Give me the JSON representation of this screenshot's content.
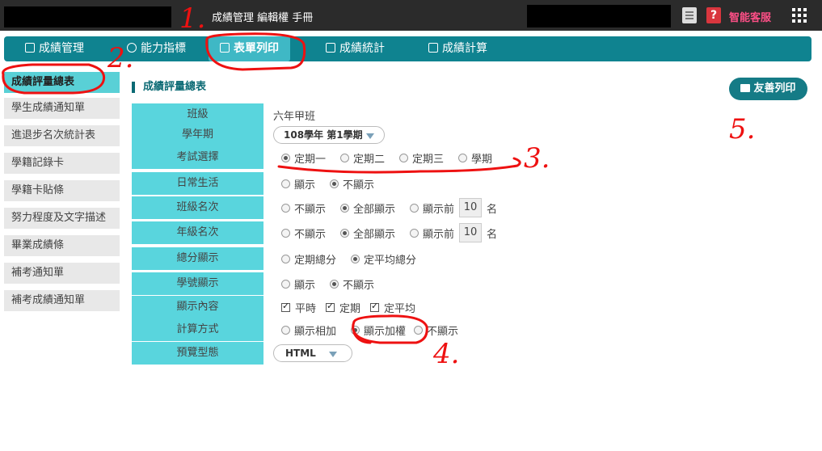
{
  "topbar": {
    "title": "成績管理 編輯權 手冊",
    "service_label": "智能客服",
    "icons": [
      "clipboard-icon",
      "help-icon",
      "apps-grid-icon"
    ]
  },
  "nav": {
    "items": [
      {
        "label": "成績管理",
        "icon": "doc-icon"
      },
      {
        "label": "能力指標",
        "icon": "target-icon"
      },
      {
        "label": "表單列印",
        "icon": "printer-icon",
        "active": true
      },
      {
        "label": "成績統計",
        "icon": "book-icon"
      },
      {
        "label": "成績計算",
        "icon": "calculator-icon"
      }
    ]
  },
  "sidebar": {
    "items": [
      {
        "label": "成績評量總表",
        "active": true
      },
      {
        "label": "學生成績通知單"
      },
      {
        "label": "進退步名次統計表"
      },
      {
        "label": "學籍記錄卡"
      },
      {
        "label": "學籍卡貼條"
      },
      {
        "label": "努力程度及文字描述"
      },
      {
        "label": "畢業成績條"
      },
      {
        "label": "補考通知單"
      },
      {
        "label": "補考成績通知單"
      }
    ]
  },
  "main": {
    "section_title": "成績評量總表",
    "print_button": "友善列印",
    "rows": {
      "class": {
        "label": "班級",
        "value": "六年甲班"
      },
      "term": {
        "label": "學年期",
        "value": "108學年 第1學期"
      },
      "exam": {
        "label": "考試選擇",
        "options": [
          "定期一",
          "定期二",
          "定期三",
          "學期"
        ],
        "selected": "定期一"
      },
      "daily": {
        "label": "日常生活",
        "options": [
          "顯示",
          "不顯示"
        ],
        "selected": "不顯示"
      },
      "class_rank": {
        "label": "班級名次",
        "options": [
          "不顯示",
          "全部顯示",
          "顯示前"
        ],
        "selected": "全部顯示",
        "top_n": "10",
        "unit": "名"
      },
      "grade_rank": {
        "label": "年級名次",
        "options": [
          "不顯示",
          "全部顯示",
          "顯示前"
        ],
        "selected": "全部顯示",
        "top_n": "10",
        "unit": "名"
      },
      "total": {
        "label": "總分顯示",
        "options": [
          "定期總分",
          "定平均總分"
        ],
        "selected": "定平均總分"
      },
      "student_no": {
        "label": "學號顯示",
        "options": [
          "顯示",
          "不顯示"
        ],
        "selected": "不顯示"
      },
      "content": {
        "label": "顯示內容",
        "checks": [
          "平時",
          "定期",
          "定平均"
        ]
      },
      "calc": {
        "label": "計算方式",
        "options": [
          "顯示相加",
          "顯示加權",
          "不顯示"
        ],
        "selected": "顯示加權"
      },
      "preview": {
        "label": "預覽型態",
        "value": "HTML"
      }
    }
  },
  "annotations": [
    "1.",
    "2.",
    "3.",
    "4.",
    "5."
  ],
  "colors": {
    "topbar": "#2b2b2b",
    "nav": "#0f8390",
    "nav_active": "#3fb8c5",
    "label_cell": "#59d5dd",
    "sidebar_active": "#59d0d6",
    "accent_pink": "#ff4f87",
    "annotation_red": "#e11111"
  }
}
